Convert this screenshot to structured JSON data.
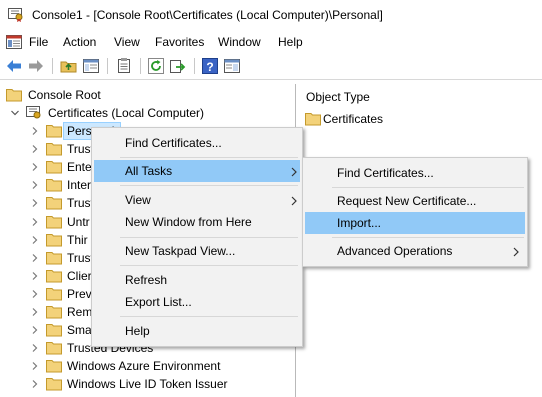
{
  "window": {
    "title": "Console1 - [Console Root\\Certificates (Local Computer)\\Personal]"
  },
  "menu": {
    "items": [
      "File",
      "Action",
      "View",
      "Favorites",
      "Window",
      "Help"
    ]
  },
  "toolbar": {
    "icons": [
      "back-icon",
      "forward-icon",
      "up-folder-icon",
      "show-hide-tree-icon",
      "properties-icon",
      "refresh-icon",
      "export-list-icon",
      "help-icon",
      "show-action-pane-icon"
    ]
  },
  "tree": {
    "root": "Console Root",
    "snapin": "Certificates (Local Computer)",
    "nodes": [
      "Personal",
      "Trusted Root Certification Authorities",
      "Enterprise Trust",
      "Intermediate Certification Authorities",
      "Trusted Publishers",
      "Untrusted Certificates",
      "Third-Party Root Certification Authorities",
      "Trusted People",
      "Client Authentication Issuers",
      "Preview Build Roots",
      "Remote Desktop",
      "Smart Card Trusted Roots",
      "Trusted Devices",
      "Windows Azure Environment",
      "Windows Live ID Token Issuer"
    ],
    "visible_labels": [
      "Personal",
      "Trust",
      "Ente",
      "Inter",
      "Trust",
      "Untr",
      "Thir",
      "Trust",
      "Clier",
      "Prev",
      "Rem",
      "Sma",
      "Trusted Devices",
      "Windows Azure Environment",
      "Windows Live ID Token Issuer"
    ]
  },
  "right_pane": {
    "column_header": "Object Type",
    "items": [
      "Certificates"
    ]
  },
  "context_menu": {
    "items": {
      "find": "Find Certificates...",
      "all_tasks": "All Tasks",
      "view": "View",
      "new_window": "New Window from Here",
      "new_taskpad": "New Taskpad View...",
      "refresh": "Refresh",
      "export": "Export List...",
      "help": "Help"
    }
  },
  "submenu": {
    "items": {
      "find": "Find Certificates...",
      "request": "Request New Certificate...",
      "import": "Import...",
      "advanced": "Advanced Operations"
    }
  },
  "colors": {
    "highlight": "#91c9f7",
    "selection": "#cce8ff",
    "menu_bg": "#f2f2f2",
    "folder": "#e8c15a"
  }
}
